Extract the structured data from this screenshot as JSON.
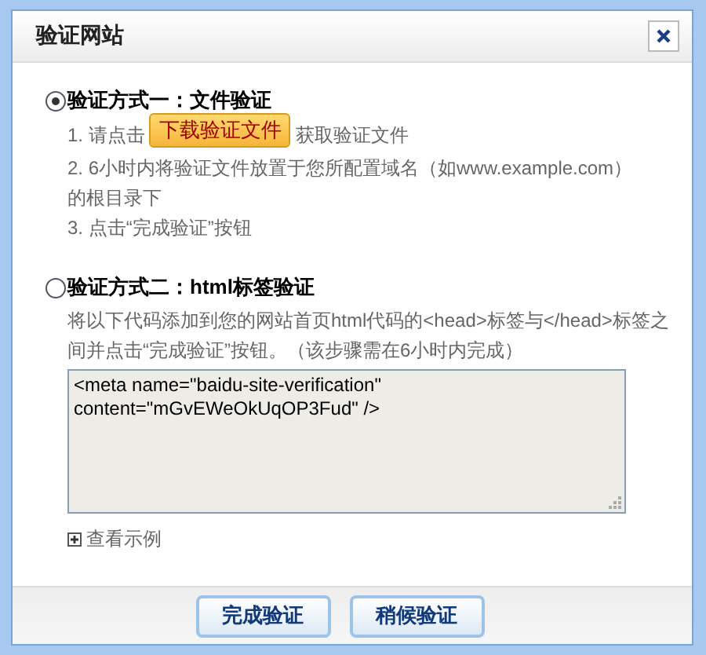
{
  "window": {
    "title": "验证网站"
  },
  "methods": [
    {
      "kind": "file",
      "label": "验证方式一：文件验证",
      "selected": true,
      "step_before": "1. 请点击",
      "download_button": "下载验证文件",
      "step_after": "获取验证文件",
      "steps": [
        "2. 6小时内将验证文件放置于您所配置域名（如www.example.com）的根目录下",
        "3. 点击“完成验证”按钮"
      ]
    },
    {
      "kind": "html",
      "label": "验证方式二：html标签验证",
      "selected": false,
      "description": "将以下代码添加到您的网站首页html代码的<head>标签与</head>标签之间并点击“完成验证”按钮。（该步骤需在6小时内完成）",
      "code": "<meta name=\"baidu-site-verification\"\ncontent=\"mGvEWeOkUqOP3Fud\" />",
      "example_link": "查看示例"
    }
  ],
  "buttons": [
    "完成验证",
    "稍候验证"
  ]
}
